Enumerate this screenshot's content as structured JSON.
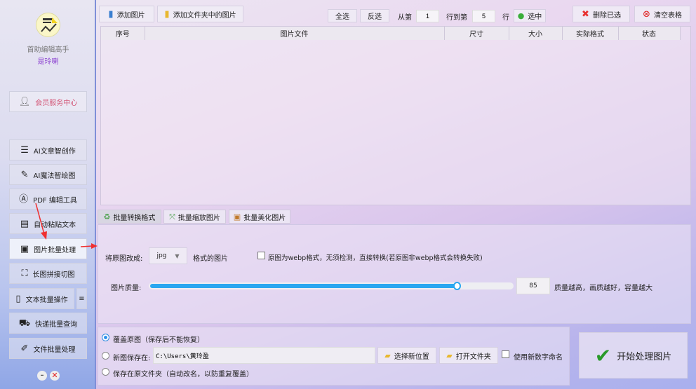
{
  "sidebar": {
    "app_name": "首助编辑高手",
    "user_name": "是玲喇",
    "member": "会员服务中心",
    "items": [
      {
        "label": "AI文章智创作",
        "icon": "lines-icon"
      },
      {
        "label": "AI魔法智绘图",
        "icon": "brush-icon"
      },
      {
        "label": "PDF 编辑工具",
        "icon": "pdf-icon"
      },
      {
        "label": "自动粘贴文本",
        "icon": "paste-icon"
      },
      {
        "label": "图片批量处理",
        "icon": "image-icon"
      },
      {
        "label": "长图拼接切图",
        "icon": "crop-icon"
      },
      {
        "label": "文本批量操作",
        "icon": "notebook-icon"
      },
      {
        "label": "快递批量查询",
        "icon": "truck-icon"
      },
      {
        "label": "文件批量处理",
        "icon": "file-edit-icon"
      }
    ],
    "menu_glyph": "≡",
    "selected": "图片批量处理"
  },
  "toolbar": {
    "add_image": "添加图片",
    "add_folder": "添加文件夹中的图片",
    "select_all": "全选",
    "invert": "反选",
    "from": "从第",
    "from_value": "1",
    "to": "行到第",
    "to_value": "5",
    "row": "行",
    "select": "选中",
    "delete_selected": "删除已选",
    "clear_table": "清空表格"
  },
  "table": {
    "columns": [
      "序号",
      "图片文件",
      "尺寸",
      "大小",
      "实际格式",
      "状态"
    ],
    "rows": []
  },
  "tabs": [
    {
      "label": "批量转换格式"
    },
    {
      "label": "批量缩放图片"
    },
    {
      "label": "批量美化图片"
    }
  ],
  "convert": {
    "label": "将原图改成:",
    "format": "jpg",
    "suffix": "格式的图片",
    "webp_check": "原图为webp格式，无须检测，直接转换(若原图非webp格式会转换失败)",
    "webp_checked": false,
    "quality_label": "图片质量:",
    "quality": 85,
    "quality_hint": "质量越高，画质越好，容量越大"
  },
  "save": {
    "overwrite": "覆盖原图（保存后不能恢复）",
    "new_location": "新图保存在:",
    "path": "C:\\Users\\黄玲盈",
    "choose": "选择新位置",
    "open_folder": "打开文件夹",
    "numeric_name": "使用新数字命名",
    "original_folder": "保存在原文件夹（自动改名，以防重复覆盖）",
    "selected": "overwrite"
  },
  "start": "开始处理图片",
  "colors": {
    "accent": "#2aa7f0",
    "member_text": "#d45a7a",
    "user_name": "#8a3fd0",
    "arrow": "#f03030"
  }
}
